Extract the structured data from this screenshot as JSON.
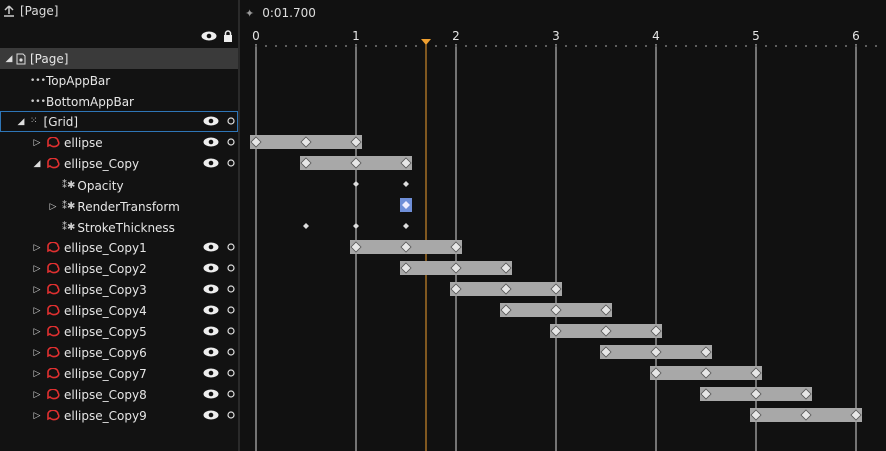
{
  "breadcrumb": {
    "label": "[Page]"
  },
  "timeline": {
    "current_time": "0:01.700",
    "playhead_seconds": 1.7,
    "ruler_labels": [
      "0",
      "1",
      "2",
      "3",
      "4",
      "5",
      "6"
    ]
  },
  "tree": {
    "page": "[Page]",
    "top_app_bar": "TopAppBar",
    "bottom_app_bar": "BottomAppBar",
    "grid": "[Grid]",
    "ellipse": "ellipse",
    "ellipse_copy": "ellipse_Copy",
    "opacity": "Opacity",
    "render_transform": "RenderTransform",
    "stroke_thickness": "StrokeThickness",
    "copies": [
      "ellipse_Copy1",
      "ellipse_Copy2",
      "ellipse_Copy3",
      "ellipse_Copy4",
      "ellipse_Copy5",
      "ellipse_Copy6",
      "ellipse_Copy7",
      "ellipse_Copy8",
      "ellipse_Copy9"
    ]
  },
  "animation_bars": [
    {
      "start": 0,
      "end": 1,
      "keys": [
        0,
        0.5,
        1
      ]
    },
    {
      "start": 0.5,
      "end": 1.5,
      "keys": [
        0.5,
        1,
        1.5
      ]
    },
    {
      "start": 1,
      "end": 2,
      "keys": [
        1,
        1.5,
        2
      ]
    },
    {
      "start": 1.5,
      "end": 2.5,
      "keys": [
        1.5,
        2,
        2.5
      ]
    },
    {
      "start": 2,
      "end": 3,
      "keys": [
        2,
        2.5,
        3
      ]
    },
    {
      "start": 2.5,
      "end": 3.5,
      "keys": [
        2.5,
        3,
        3.5
      ]
    },
    {
      "start": 3,
      "end": 4,
      "keys": [
        3,
        3.5,
        4
      ]
    },
    {
      "start": 3.5,
      "end": 4.5,
      "keys": [
        3.5,
        4,
        4.5
      ]
    },
    {
      "start": 4,
      "end": 5,
      "keys": [
        4,
        4.5,
        5
      ]
    },
    {
      "start": 4.5,
      "end": 5.5,
      "keys": [
        4.5,
        5,
        5.5
      ]
    },
    {
      "start": 5,
      "end": 6,
      "keys": [
        5,
        5.5,
        6
      ]
    }
  ],
  "property_keys": {
    "opacity": [
      1,
      1.5
    ],
    "render_transform": [
      1.5
    ],
    "stroke_thickness": [
      0.5,
      1,
      1.5
    ]
  },
  "colors": {
    "playhead": "#f0a030",
    "bar": "#a8a8a8",
    "selected_key": "#6f8fd8",
    "accent_red": "#e03030"
  }
}
